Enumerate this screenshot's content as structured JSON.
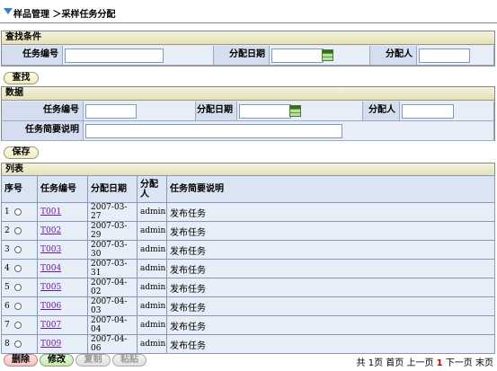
{
  "breadcrumb": {
    "text": "样品管理 ＞采样任务分配"
  },
  "search": {
    "title": "查找条件",
    "task_no_label": "任务编号",
    "task_no_value": "",
    "date_label": "分配日期",
    "date_value": "",
    "assignee_label": "分配人",
    "assignee_value": "",
    "find_button": "查找"
  },
  "data_form": {
    "title": "数据",
    "task_no_label": "任务编号",
    "date_label": "分配日期",
    "assignee_label": "分配人",
    "desc_label": "任务简要说明",
    "save_button": "保存"
  },
  "list": {
    "title": "列表",
    "headers": {
      "seq": "序号",
      "task_no": "任务编号",
      "date": "分配日期",
      "assignee": "分配人",
      "desc": "任务简要说明"
    },
    "rows": [
      {
        "seq": "1",
        "task_no": "T001",
        "date": "2007-03-27",
        "assignee": "admin",
        "desc": "发布任务"
      },
      {
        "seq": "2",
        "task_no": "T002",
        "date": "2007-03-29",
        "assignee": "admin",
        "desc": "发布任务"
      },
      {
        "seq": "3",
        "task_no": "T003",
        "date": "2007-03-30",
        "assignee": "admin",
        "desc": "发布任务"
      },
      {
        "seq": "4",
        "task_no": "T004",
        "date": "2007-03-31",
        "assignee": "admin",
        "desc": "发布任务"
      },
      {
        "seq": "5",
        "task_no": "T005",
        "date": "2007-04-02",
        "assignee": "admin",
        "desc": "发布任务"
      },
      {
        "seq": "6",
        "task_no": "T006",
        "date": "2007-04-03",
        "assignee": "admin",
        "desc": "发布任务"
      },
      {
        "seq": "7",
        "task_no": "T007",
        "date": "2007-04-04",
        "assignee": "admin",
        "desc": "发布任务"
      },
      {
        "seq": "8",
        "task_no": "T009",
        "date": "2007-04-06",
        "assignee": "admin",
        "desc": "发布任务"
      }
    ]
  },
  "actions": {
    "delete": "删除",
    "edit": "修改",
    "copy": "复制",
    "paste": "粘贴"
  },
  "pager": {
    "total_prefix": "共",
    "total_pages": "1",
    "total_suffix": "页",
    "first": "首页",
    "prev": "上一页",
    "current": "1",
    "next": "下一页",
    "last": "末页"
  }
}
